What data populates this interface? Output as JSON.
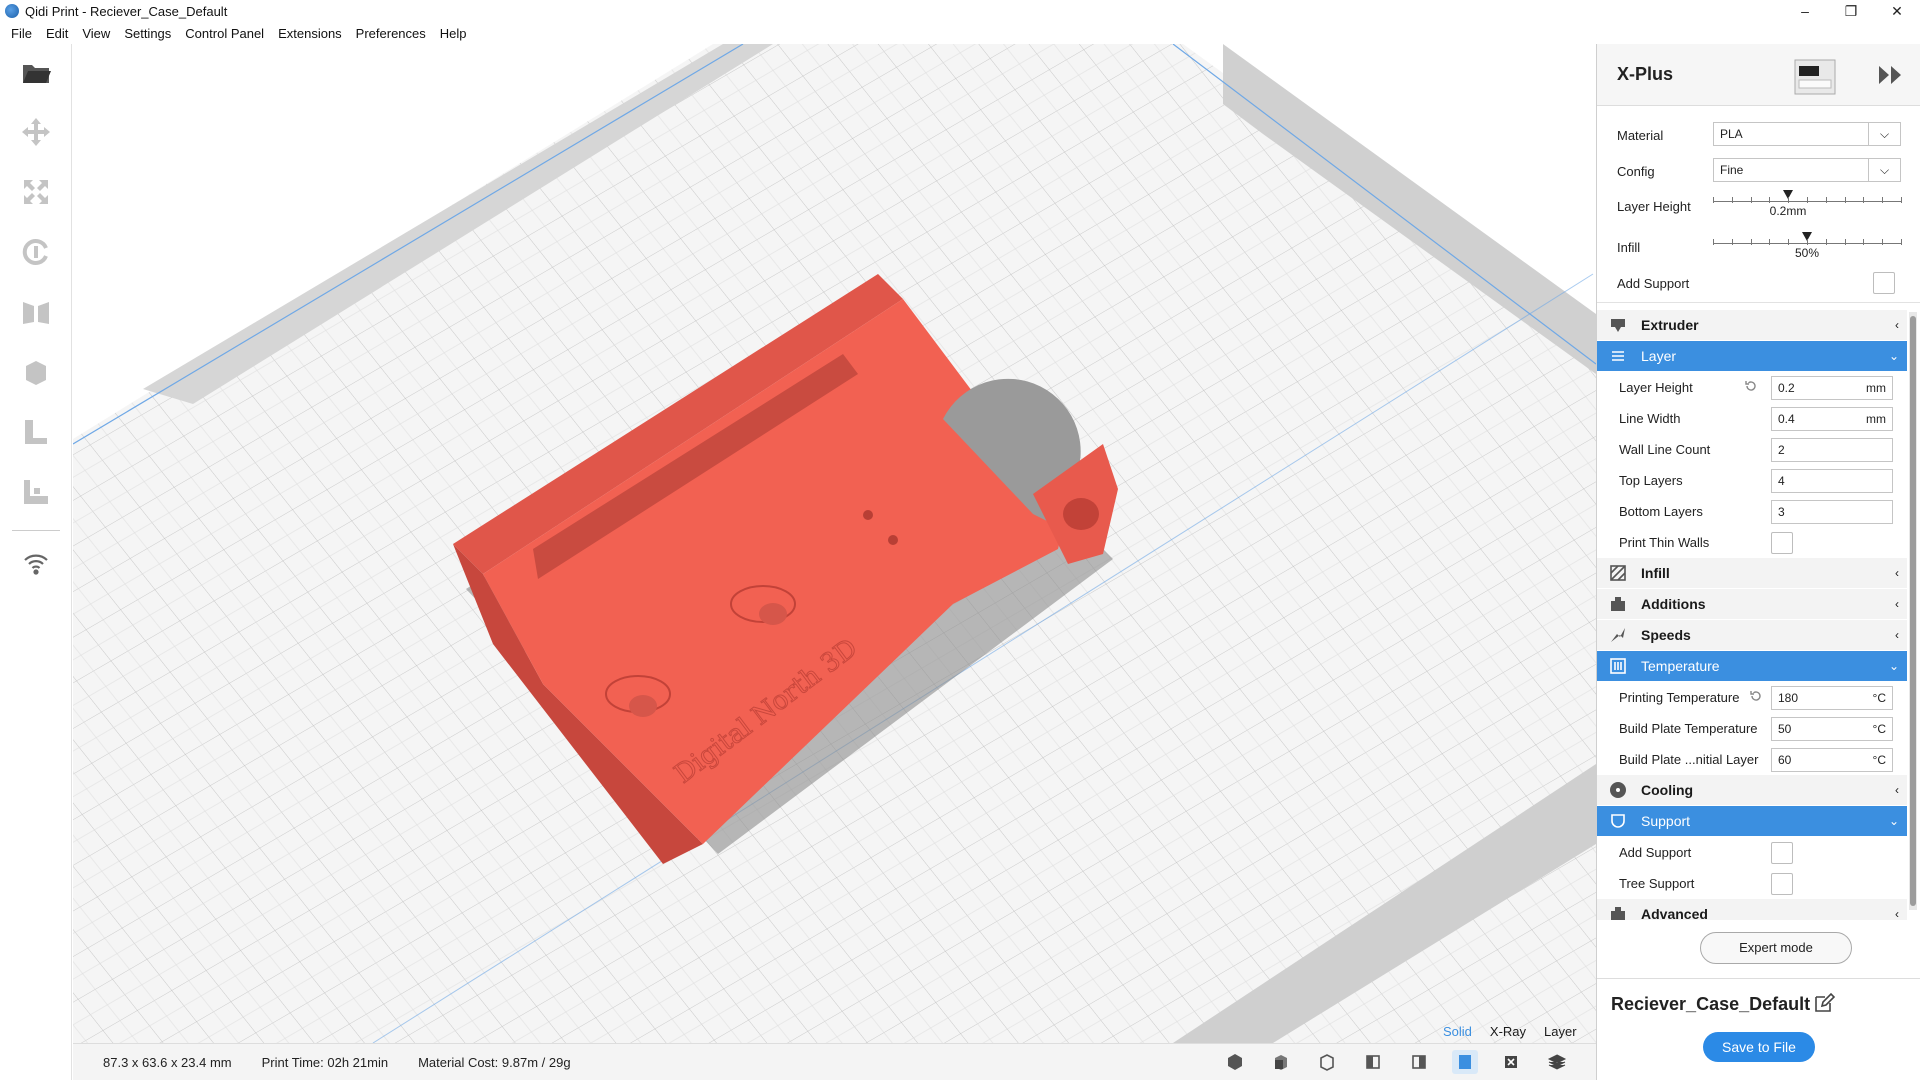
{
  "window": {
    "title": "Qidi Print - Reciever_Case_Default"
  },
  "menu": [
    "File",
    "Edit",
    "View",
    "Settings",
    "Control Panel",
    "Extensions",
    "Preferences",
    "Help"
  ],
  "left_tools": [
    "open-folder-icon",
    "move-icon",
    "scale-icon",
    "rotate-icon",
    "mirror-icon",
    "per-model-settings-icon",
    "support-blocker-icon",
    "lay-flat-icon",
    "wifi-icon"
  ],
  "printer": {
    "name": "X-Plus"
  },
  "quick": {
    "material_label": "Material",
    "material_value": "PLA",
    "config_label": "Config",
    "config_value": "Fine",
    "layer_height_label": "Layer Height",
    "layer_height_value": "0.2mm",
    "layer_height_level": 0.4,
    "infill_label": "Infill",
    "infill_value": "50%",
    "infill_level": 0.5,
    "add_support_label": "Add Support"
  },
  "sections": {
    "extruder": "Extruder",
    "layer": "Layer",
    "infill": "Infill",
    "additions": "Additions",
    "speeds": "Speeds",
    "temperature": "Temperature",
    "cooling": "Cooling",
    "support": "Support",
    "advanced": "Advanced"
  },
  "layer_settings": [
    {
      "label": "Layer Height",
      "value": "0.2",
      "unit": "mm"
    },
    {
      "label": "Line Width",
      "value": "0.4",
      "unit": "mm"
    },
    {
      "label": "Wall Line Count",
      "value": "2",
      "unit": ""
    },
    {
      "label": "Top Layers",
      "value": "4",
      "unit": ""
    },
    {
      "label": "Bottom Layers",
      "value": "3",
      "unit": ""
    },
    {
      "label": "Print Thin Walls"
    }
  ],
  "temperature_settings": [
    {
      "label": "Printing Temperature",
      "value": "180",
      "unit": "°C"
    },
    {
      "label": "Build Plate Temperature",
      "value": "50",
      "unit": "°C"
    },
    {
      "label": "Build Plate ...nitial Layer",
      "value": "60",
      "unit": "°C"
    }
  ],
  "support_settings": [
    {
      "label": "Add Support"
    },
    {
      "label": "Tree Support"
    }
  ],
  "buttons": {
    "expert_mode": "Expert mode",
    "save_to_file": "Save to File"
  },
  "job": {
    "name": "Reciever_Case_Default"
  },
  "viewport": {
    "model_label": "Digital North 3D",
    "view_modes": [
      "Solid",
      "X-Ray",
      "Layer"
    ],
    "active_view_mode": "Solid"
  },
  "status": {
    "dimensions": "87.3 x 63.6 x 23.4 mm",
    "print_time_label": "Print Time:",
    "print_time_value": "02h 21min",
    "material_cost_label": "Material Cost:",
    "material_cost_value": "9.87m / 29g"
  },
  "camera_views": [
    "3d-view-icon",
    "front-view-icon",
    "top-view-icon",
    "left-view-icon",
    "right-view-icon",
    "solid-view-icon",
    "xray-view-icon",
    "layer-view-icon"
  ],
  "colors": {
    "accent": "#3b8fe0",
    "model": "#f26152",
    "save": "#2b8ae6"
  }
}
